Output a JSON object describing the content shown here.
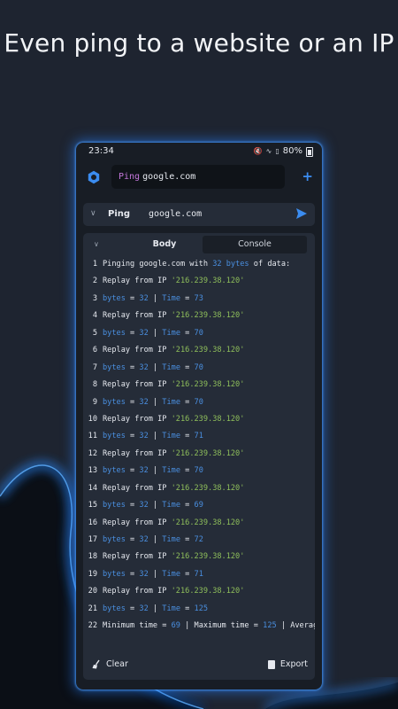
{
  "headline": "Even ping to a website or an IP",
  "status_bar": {
    "time": "23:34",
    "battery": "80%",
    "icons": [
      "mute-icon",
      "wifi-icon",
      "signal-icon",
      "battery-icon"
    ]
  },
  "url_bar": {
    "keyword": "Ping",
    "host": "google.com"
  },
  "request": {
    "method": "Ping",
    "host": "google.com"
  },
  "tabs": {
    "body": "Body",
    "console": "Console",
    "active": "Console"
  },
  "console": {
    "header": {
      "pre": "Pinging google.com with",
      "count": "32",
      "unit": "bytes",
      "post": "of data:"
    },
    "reply_prefix": "Replay from IP",
    "ip": "'216.239.38.120'",
    "bytes_label": "bytes",
    "time_label": "Time",
    "bytes_value": "32",
    "times": [
      "73",
      "70",
      "70",
      "70",
      "71",
      "70",
      "69",
      "72",
      "71",
      "125"
    ],
    "summary": {
      "min_label": "Minimum time",
      "min": "69",
      "max_label": "Maximum time",
      "max": "125",
      "avg_label": "Average"
    }
  },
  "actions": {
    "clear": "Clear",
    "export": "Export"
  },
  "colors": {
    "accent": "#3b8cf0",
    "ip": "#8fbf5b",
    "number": "#4a8fe0",
    "keyword": "#c678dd"
  }
}
